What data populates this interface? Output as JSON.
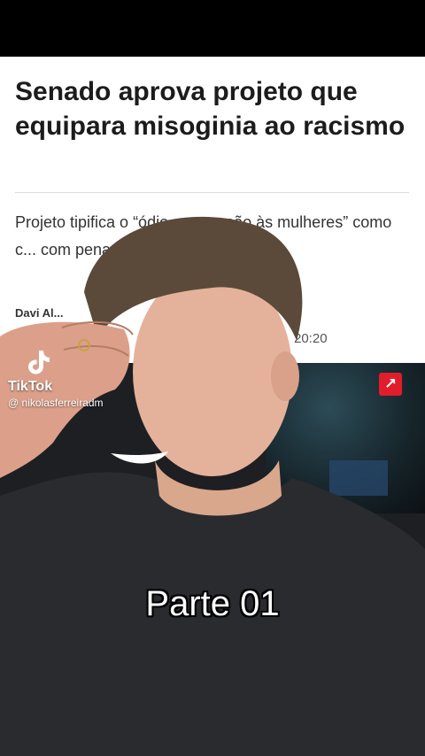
{
  "article": {
    "headline": "Senado aprova projeto que equipara misoginia ao racismo",
    "summary": "Projeto tipifica o “ódio ou aversão às mulheres” como c... com pena de reclusão... multa",
    "byline": "Davi Al...",
    "time": "20:20"
  },
  "watermark": {
    "brand": "TikTok",
    "username": "@ nikolasferreiradm"
  },
  "video": {
    "caption": "Parte 01"
  },
  "icons": {
    "share_badge": "external-link-icon",
    "logo": "tiktok-logo-icon"
  },
  "colors": {
    "badge": "#e11d2b"
  }
}
